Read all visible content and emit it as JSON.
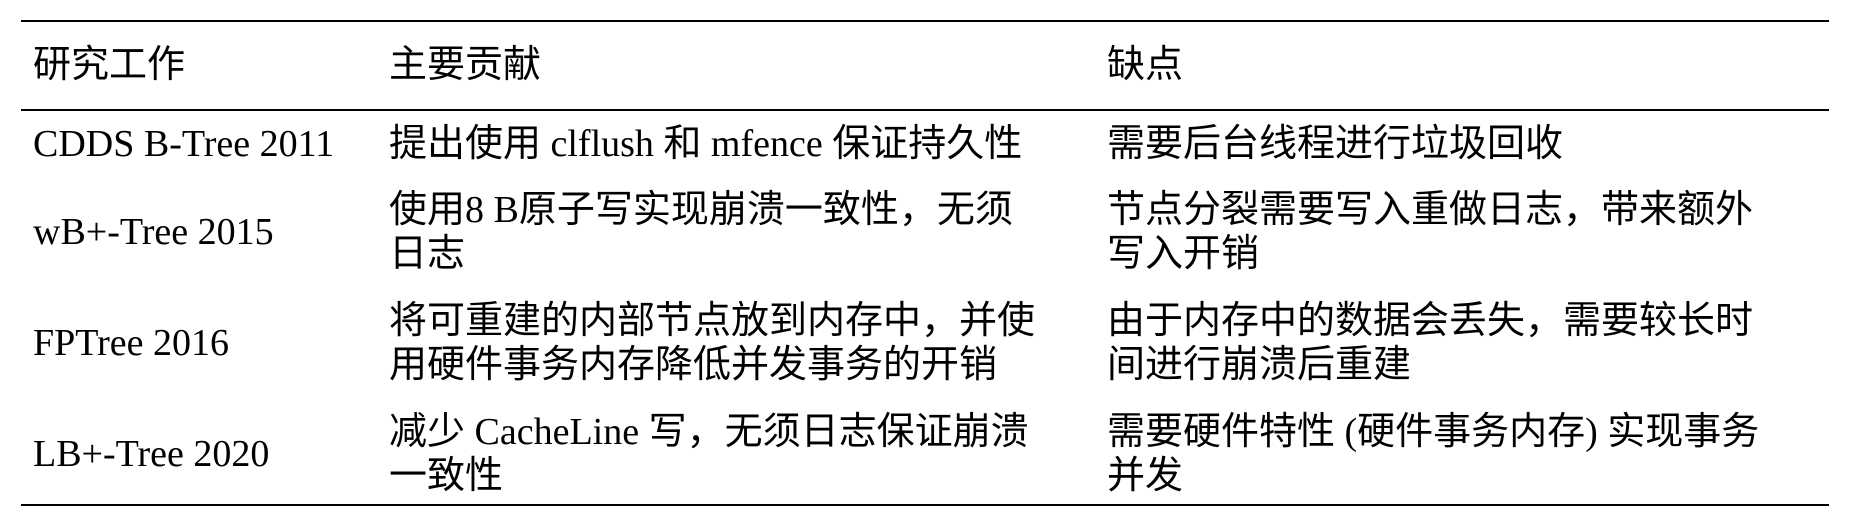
{
  "table": {
    "headers": [
      "研究工作",
      "主要贡献",
      "缺点"
    ],
    "rows": [
      {
        "work": [
          "CDDS B-Tree 2011"
        ],
        "contribution": [
          "提出使用 clflush 和 mfence 保证持久性"
        ],
        "drawback": [
          "需要后台线程进行垃圾回收"
        ]
      },
      {
        "work": [
          "wB+-Tree 2015"
        ],
        "contribution": [
          "使用8 B原子写实现崩溃一致性，无须",
          "日志"
        ],
        "drawback": [
          "节点分裂需要写入重做日志，带来额外",
          "写入开销"
        ]
      },
      {
        "work": [
          "FPTree 2016"
        ],
        "contribution": [
          "将可重建的内部节点放到内存中，并使",
          "用硬件事务内存降低并发事务的开销"
        ],
        "drawback": [
          "由于内存中的数据会丢失，需要较长时",
          "间进行崩溃后重建"
        ]
      },
      {
        "work": [
          "LB+-Tree 2020"
        ],
        "contribution": [
          "减少 CacheLine 写，无须日志保证崩溃",
          "一致性"
        ],
        "drawback": [
          "需要硬件特性 (硬件事务内存) 实现事务",
          "并发"
        ]
      }
    ]
  }
}
